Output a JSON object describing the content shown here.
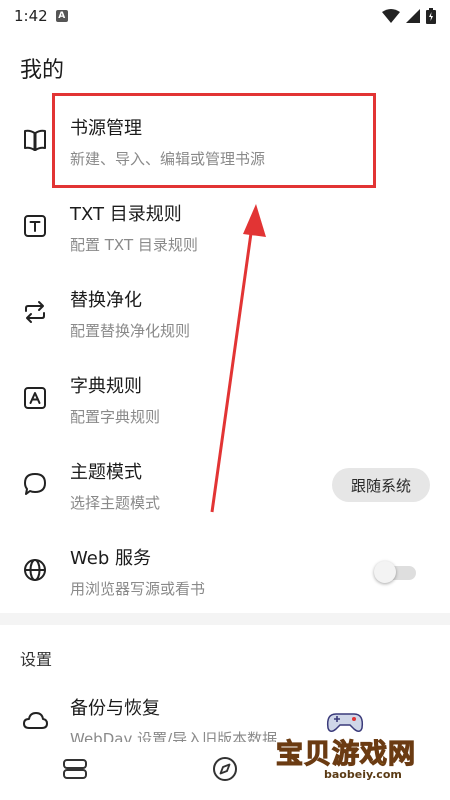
{
  "status_bar": {
    "time": "1:42",
    "badge": "A"
  },
  "page_title": "我的",
  "items": [
    {
      "title": "书源管理",
      "subtitle": "新建、导入、编辑或管理书源",
      "icon": "book-open-icon"
    },
    {
      "title": "TXT 目录规则",
      "subtitle": "配置 TXT 目录规则",
      "icon": "text-box-icon"
    },
    {
      "title": "替换净化",
      "subtitle": "配置替换净化规则",
      "icon": "swap-arrows-icon"
    },
    {
      "title": "字典规则",
      "subtitle": "配置字典规则",
      "icon": "letter-box-icon"
    },
    {
      "title": "主题模式",
      "subtitle": "选择主题模式",
      "icon": "speech-bubble-icon",
      "value": "跟随系统"
    },
    {
      "title": "Web 服务",
      "subtitle": "用浏览器写源或看书",
      "icon": "globe-icon",
      "toggle_on": false
    }
  ],
  "settings_section": {
    "label": "设置",
    "items": [
      {
        "title": "备份与恢复",
        "subtitle": "WebDav 设置/导入旧版本数据",
        "icon": "cloud-icon"
      }
    ]
  },
  "bottom_nav": [
    {
      "name": "bookshelf-icon"
    },
    {
      "name": "compass-icon"
    }
  ],
  "watermark": {
    "text": "宝贝游戏网",
    "url": "baobeiy.com"
  },
  "colors": {
    "highlight": "#e23434",
    "arrow": "#e23434",
    "subtext": "#8a8a8a"
  }
}
